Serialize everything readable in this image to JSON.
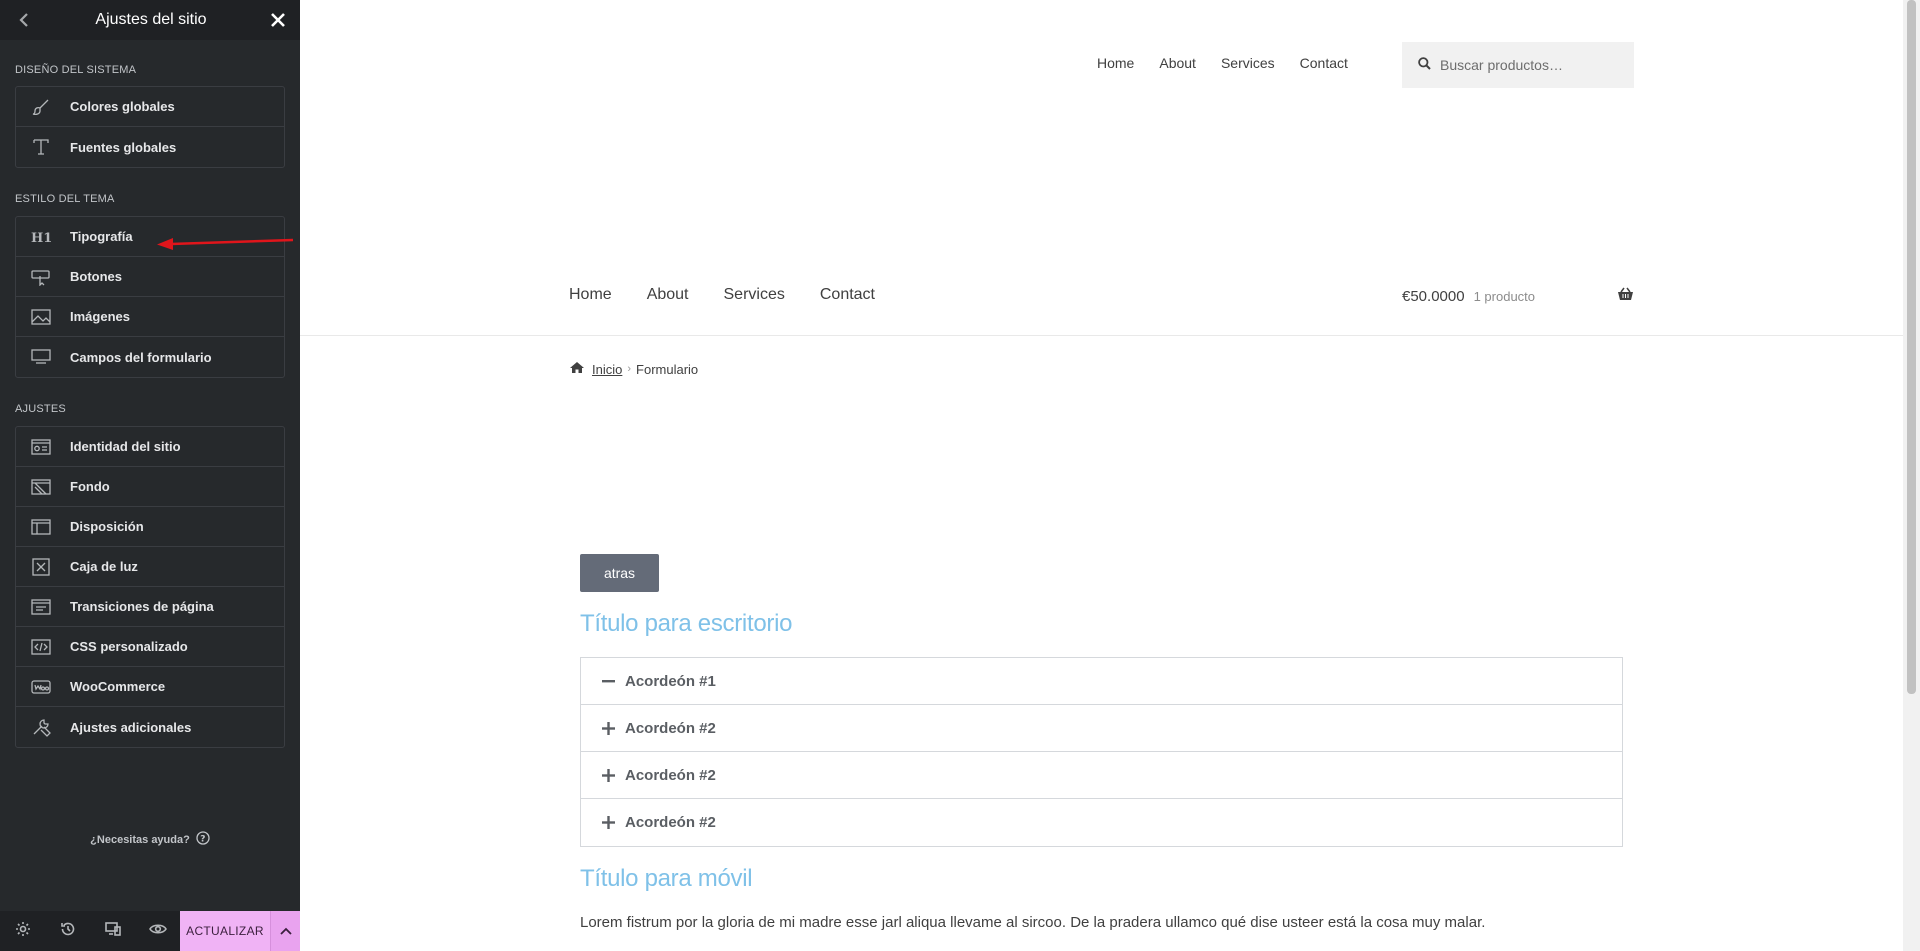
{
  "panel": {
    "title": "Ajustes del sitio",
    "sections": [
      {
        "title": "DISEÑO DEL SISTEMA",
        "items": [
          {
            "label": "Colores globales",
            "icon": "brush-icon"
          },
          {
            "label": "Fuentes globales",
            "icon": "font-icon"
          }
        ]
      },
      {
        "title": "ESTILO DEL TEMA",
        "items": [
          {
            "label": "Tipografía",
            "icon": "h1-icon"
          },
          {
            "label": "Botones",
            "icon": "button-pointer-icon"
          },
          {
            "label": "Imágenes",
            "icon": "image-icon"
          },
          {
            "label": "Campos del formulario",
            "icon": "form-field-icon"
          }
        ]
      },
      {
        "title": "AJUSTES",
        "items": [
          {
            "label": "Identidad del sitio",
            "icon": "site-identity-icon"
          },
          {
            "label": "Fondo",
            "icon": "background-icon"
          },
          {
            "label": "Disposición",
            "icon": "layout-icon"
          },
          {
            "label": "Caja de luz",
            "icon": "lightbox-icon"
          },
          {
            "label": "Transiciones de página",
            "icon": "page-transitions-icon"
          },
          {
            "label": "CSS personalizado",
            "icon": "code-icon"
          },
          {
            "label": "WooCommerce",
            "icon": "woocommerce-icon"
          },
          {
            "label": "Ajustes adicionales",
            "icon": "tools-icon"
          }
        ]
      }
    ],
    "help_label": "¿Necesitas ayuda?",
    "update_label": "ACTUALIZAR"
  },
  "preview": {
    "top_nav": [
      "Home",
      "About",
      "Services",
      "Contact"
    ],
    "search_placeholder": "Buscar productos…",
    "main_nav": [
      "Home",
      "About",
      "Services",
      "Contact"
    ],
    "cart": {
      "total": "€50.0000",
      "count": "1 producto"
    },
    "breadcrumb": {
      "home": "Inicio",
      "current": "Formulario"
    },
    "back_button": "atras",
    "heading_desktop": "Título para escritorio",
    "accordion": [
      {
        "label": "Acordeón #1",
        "state": "expanded"
      },
      {
        "label": "Acordeón #2",
        "state": "collapsed"
      },
      {
        "label": "Acordeón #2",
        "state": "collapsed"
      },
      {
        "label": "Acordeón #2",
        "state": "collapsed"
      }
    ],
    "heading_mobile": "Título para móvil",
    "lorem": "Lorem fistrum por la gloria de mi madre esse jarl aliqua llevame al sircoo. De la pradera ullamco qué dise usteer está la cosa muy malar."
  },
  "colors": {
    "panel_bg": "#26292c",
    "update_button": "#f0b3f5",
    "heading_accent": "#7fc1e8",
    "annotation_arrow": "#e0151b"
  }
}
